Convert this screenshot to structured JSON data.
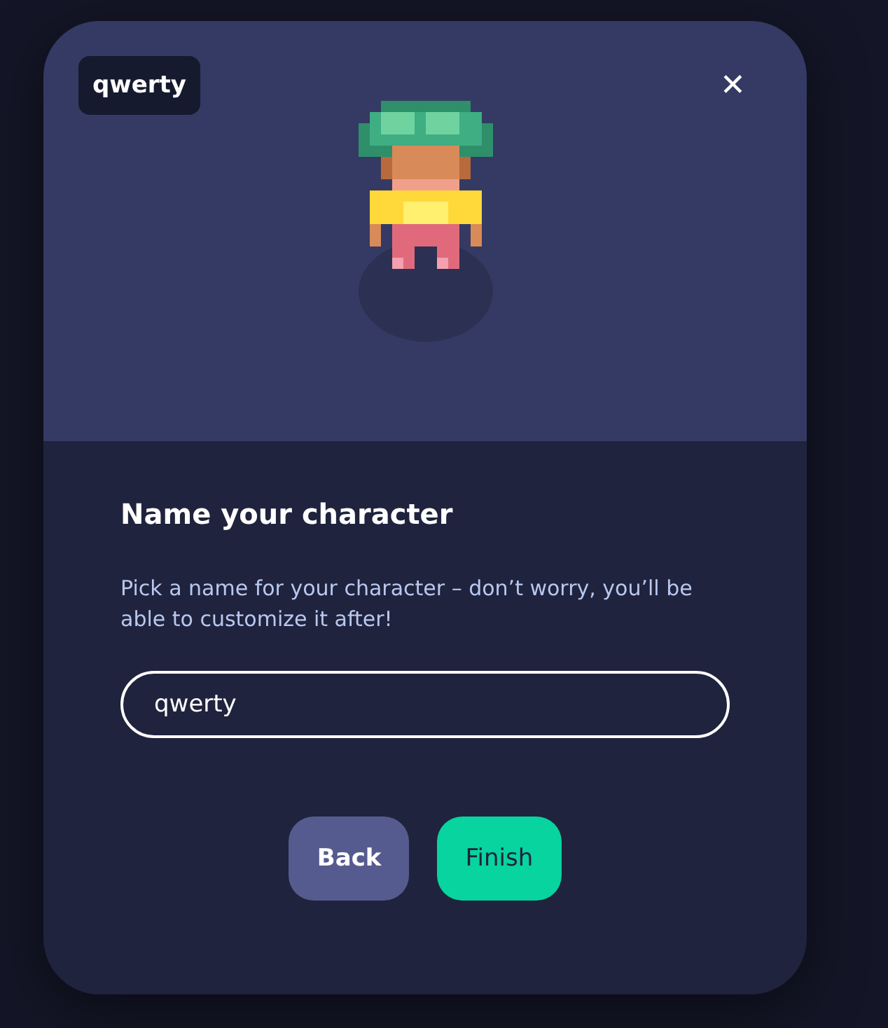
{
  "modal": {
    "name_chip": "qwerty",
    "close_icon": "✕",
    "title": "Name your character",
    "description": "Pick a name for your character – don’t worry, you’ll be able to customize it after!",
    "name_field": {
      "value": "qwerty"
    },
    "buttons": [
      {
        "label": "Back",
        "kind": "secondary"
      },
      {
        "label": "Finish",
        "kind": "primary"
      }
    ]
  }
}
